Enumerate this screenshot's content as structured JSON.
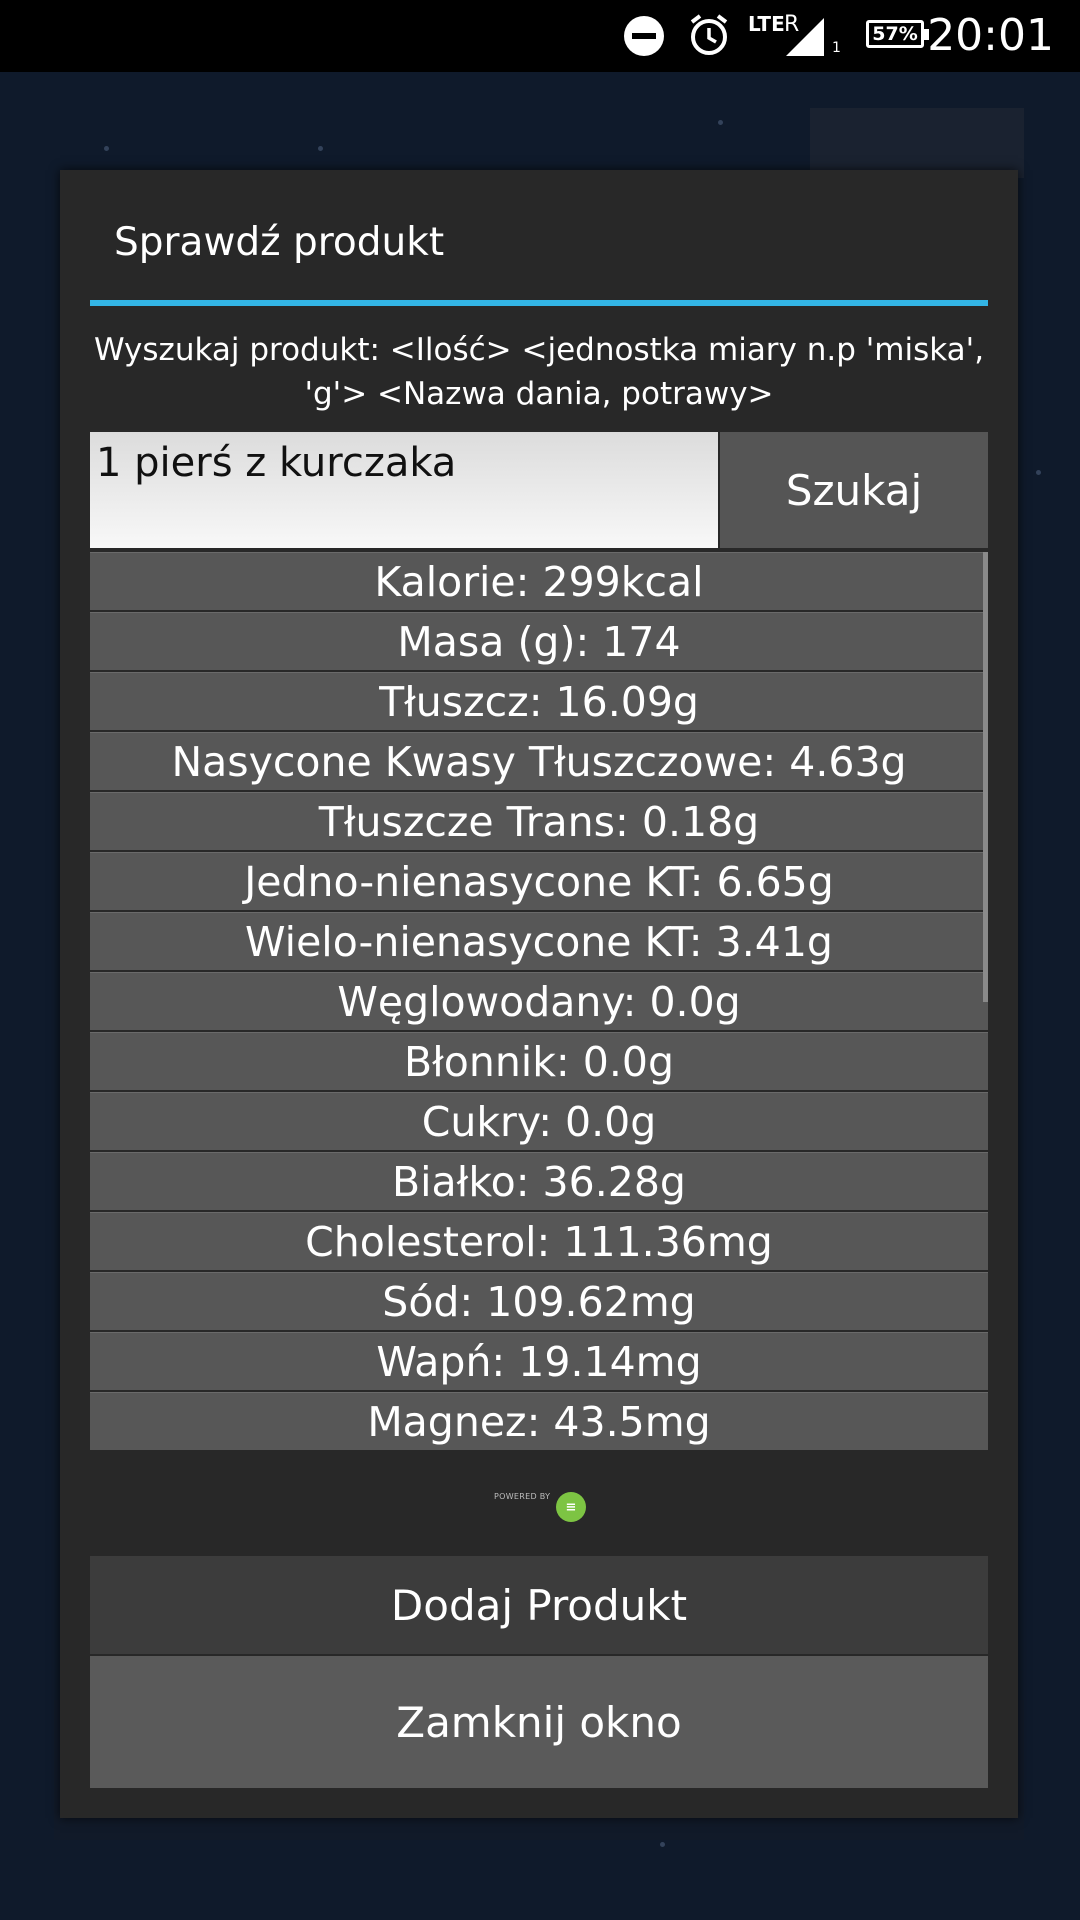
{
  "status_bar": {
    "time": "20:01",
    "battery": "57%",
    "network": "LTE",
    "roaming": "R",
    "sim": "1",
    "icons": [
      "do-not-disturb-icon",
      "alarm-icon",
      "signal-icon",
      "battery-icon"
    ]
  },
  "dialog": {
    "title": "Sprawdź produkt",
    "instructions": "Wyszukaj produkt: <Ilość> <jednostka miary n.p 'miska', 'g'> <Nazwa dania, potrawy>",
    "search": {
      "value": "1 pierś z kurczaka",
      "button_label": "Szukaj"
    },
    "results": [
      "Kalorie: 299kcal",
      "Masa (g): 174",
      "Tłuszcz: 16.09g",
      "Nasycone Kwasy Tłuszczowe: 4.63g",
      "Tłuszcze Trans: 0.18g",
      "Jedno-nienasycone KT: 6.65g",
      "Wielo-nienasycone KT: 3.41g",
      "Węglowodany: 0.0g",
      "Błonnik: 0.0g",
      "Cukry: 0.0g",
      "Białko: 36.28g",
      "Cholesterol: 111.36mg",
      "Sód: 109.62mg",
      "Wapń: 19.14mg",
      "Magnez: 43.5mg"
    ],
    "powered_by": "POWERED BY",
    "add_button": "Dodaj Produkt",
    "close_button": "Zamknij okno"
  },
  "colors": {
    "accent": "#33b5e5",
    "dialog_bg": "#282828",
    "row_bg": "#575757",
    "logo_green": "#7dc443"
  }
}
